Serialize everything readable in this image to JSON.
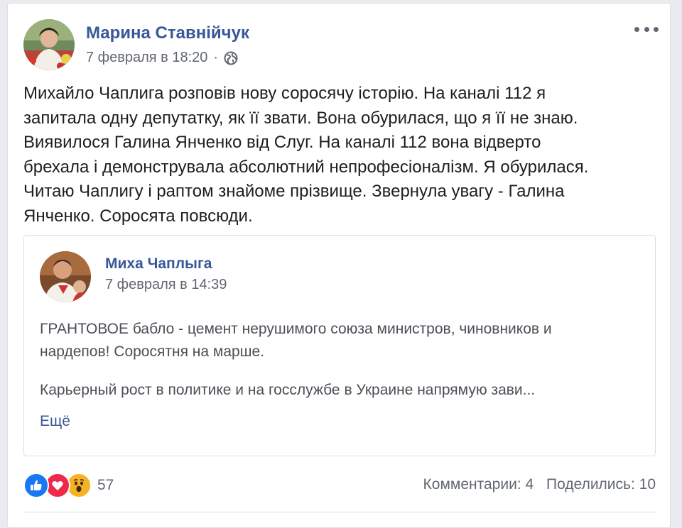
{
  "post": {
    "author": "Марина Ставнійчук",
    "date": "7 февраля в 18:20",
    "separator": "·",
    "privacy_icon": "globe-icon",
    "more_icon": "more-options-icon",
    "text_lines": [
      "Михайло Чаплига розповів нову соросячу історію. На каналі 112 я",
      "запитала одну депутатку, як її звати. Вона обурилася, що я її не знаю.",
      "Виявилося Галина Янченко від Слуг. На каналі 112 вона відверто",
      "брехала і демонструвала абсолютний непрофесіоналізм. Я обурилася.",
      "Читаю Чаплигу і раптом знайоме прізвище. Звернула увагу - Галина",
      "Янченко. Соросята повсюди."
    ]
  },
  "shared": {
    "author": "Миха Чаплыга",
    "date": "7 февраля в 14:39",
    "paragraph1_lines": [
      "ГРАНТОВОЕ бабло - цемент нерушимого союза министров, чиновников и",
      "нардепов! Соросятня на марше."
    ],
    "paragraph2_lines": [
      "Карьерный рост в политике и на госслужбе в Украине напрямую зави..."
    ],
    "see_more": "Ещё"
  },
  "footer": {
    "reaction_icons": [
      "like-icon",
      "love-icon",
      "wow-icon"
    ],
    "reaction_count": "57",
    "comments": "Комментарии: 4",
    "shares": "Поделились: 10"
  },
  "colors": {
    "link": "#385898",
    "secondary_text": "#616770",
    "like": "#1877f2",
    "love": "#f0284a",
    "wow": "#f7b125"
  }
}
